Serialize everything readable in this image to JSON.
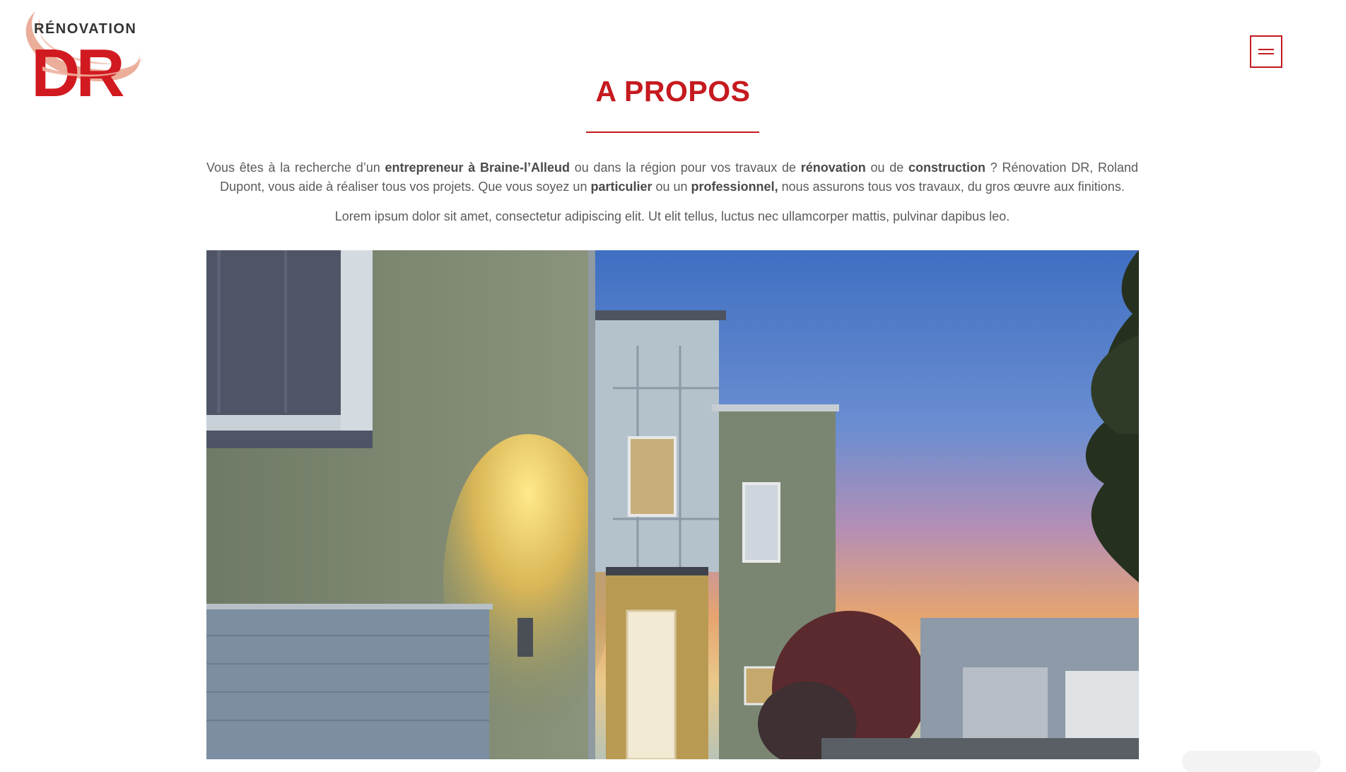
{
  "header": {
    "logo_text_top": "RÉNOVATION",
    "logo_text_main": "DR",
    "menu_icon": "hamburger-menu-icon"
  },
  "section": {
    "title": "A PROPOS",
    "intro": {
      "p1": "Vous êtes à la recherche d’un ",
      "b1": "entrepreneur à Braine-l’Alleud",
      "p2": " ou dans la région pour vos travaux de ",
      "b2": "rénovation",
      "p3": " ou de ",
      "b3": "construction",
      "p4": " ? Rénovation DR, Roland Dupont, vous aide à réaliser tous vos projets. Que vous soyez un ",
      "b4": "particulier",
      "p5": " ou un ",
      "b5": "professionnel,",
      "p6": " nous assurons tous vos travaux, du gros œuvre aux finitions."
    },
    "lorem": "Lorem ipsum dolor sit amet, consectetur adipiscing elit. Ut elit tellus, luctus nec ullamcorper mattis, pulvinar dapibus leo."
  },
  "colors": {
    "brand_red": "#c51a1f",
    "logo_swoosh": "#e8a08a",
    "text": "#5b5b5b"
  }
}
